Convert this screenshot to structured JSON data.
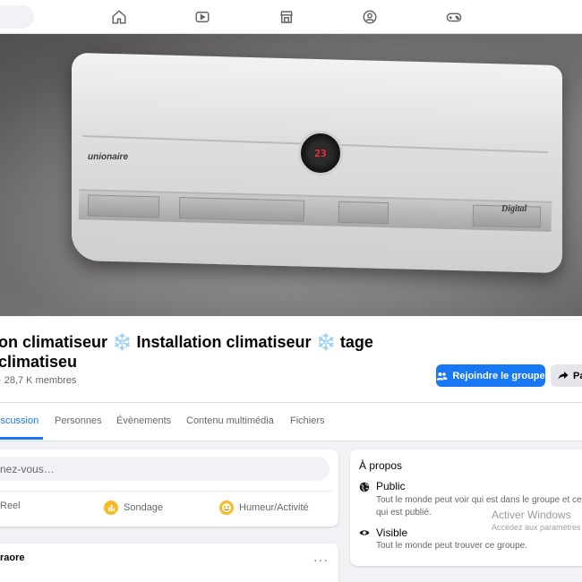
{
  "nav": {
    "icons": [
      "home-icon",
      "video-icon",
      "marketplace-icon",
      "groups-icon",
      "gaming-icon"
    ]
  },
  "cover": {
    "brand_text": "unionaire",
    "display_text": "23",
    "digital_text": "Digital"
  },
  "group": {
    "title": "on climatiseur ❄️ Installation climatiseur ❄️ tage climatiseu",
    "meta": "· 28,7 K membres",
    "join_label": "Rejoindre le groupe",
    "share_label": "Pa"
  },
  "tabs": [
    {
      "label": "iscussion",
      "active": true
    },
    {
      "label": "Personnes",
      "active": false
    },
    {
      "label": "Évènements",
      "active": false
    },
    {
      "label": "Contenu multimédia",
      "active": false
    },
    {
      "label": "Fichiers",
      "active": false
    }
  ],
  "composer": {
    "placeholder": "nez-vous…",
    "actions": [
      {
        "label": "Reel",
        "icon": "reel-icon"
      },
      {
        "label": "Sondage",
        "icon": "poll-icon",
        "color": "#f7b928"
      },
      {
        "label": "Humeur/Activité",
        "icon": "feeling-icon",
        "color": "#f7b928"
      }
    ]
  },
  "post": {
    "author": "raore",
    "more": "···"
  },
  "about": {
    "title": "À propos",
    "rows": [
      {
        "icon": "globe-icon",
        "title": "Public",
        "desc": "Tout le monde peut voir qui est dans le groupe et ce qui est publié."
      },
      {
        "icon": "eye-icon",
        "title": "Visible",
        "desc": "Tout le monde peut trouver ce groupe."
      }
    ]
  },
  "watermark": {
    "line1": "Activer Windows",
    "line2": "Accédez aux paramètres"
  },
  "colors": {
    "accent": "#1877f2",
    "background": "#f0f2f5",
    "muted": "#65676b"
  }
}
